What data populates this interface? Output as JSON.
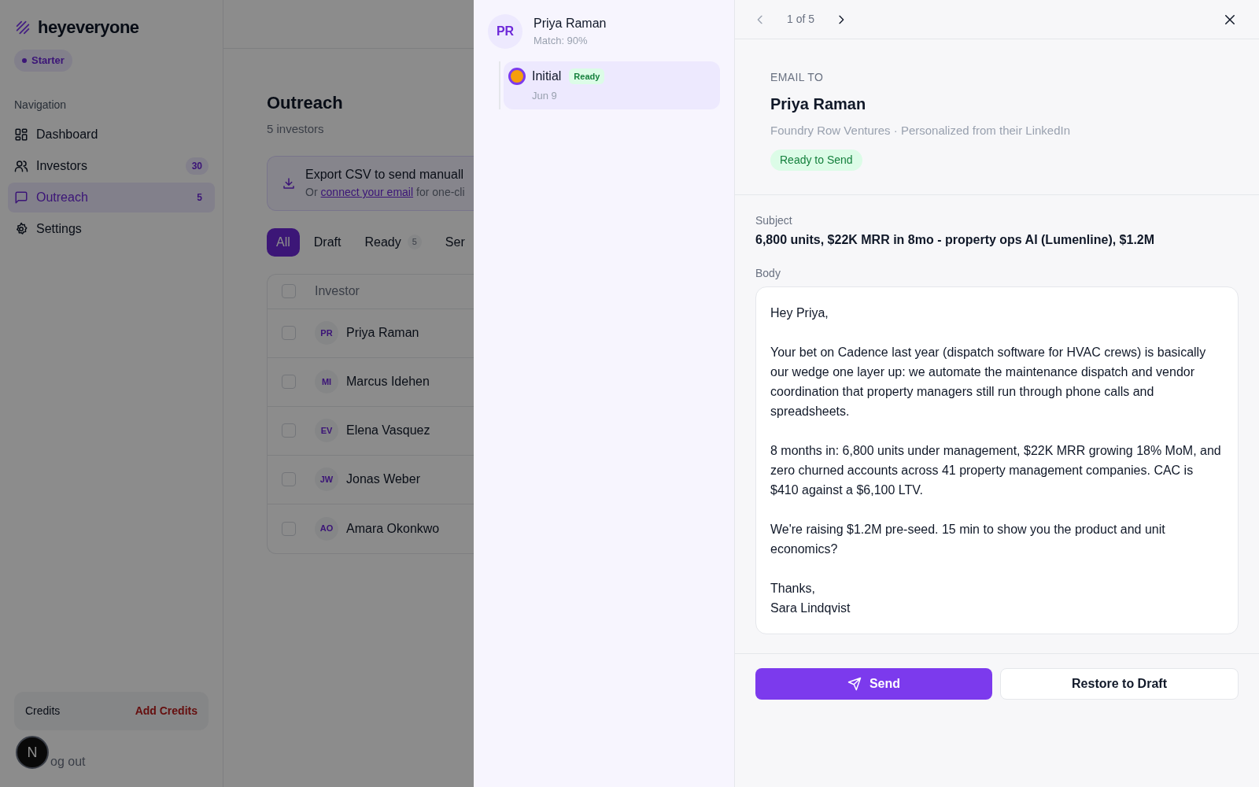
{
  "sidebar": {
    "brand": "heyeveryone",
    "plan": "Starter",
    "section_label": "Navigation",
    "items": [
      {
        "label": "Dashboard",
        "selected": false
      },
      {
        "label": "Investors",
        "badge": "30",
        "selected": false
      },
      {
        "label": "Outreach",
        "badge": "5",
        "selected": true
      },
      {
        "label": "Settings",
        "selected": false
      }
    ],
    "credits": {
      "label": "Credits",
      "action": "Add Credits"
    },
    "dev_button": "N",
    "logout": "og out"
  },
  "main": {
    "title": "Outreach",
    "subtitle": "5 investors",
    "export": {
      "title": "Export CSV to send manuall",
      "prefix": "Or ",
      "link": "connect your email",
      "suffix": " for one-cli"
    },
    "tabs": [
      {
        "label": "All",
        "selected": true
      },
      {
        "label": "Draft",
        "selected": false
      },
      {
        "label": "Ready",
        "count": "5",
        "selected": false
      },
      {
        "label": "Ser",
        "selected": false
      }
    ],
    "table": {
      "select_all_checked": false,
      "columns": [
        "Investor"
      ],
      "rows": [
        {
          "initials": "PR",
          "name": "Priya Raman",
          "checked": false
        },
        {
          "initials": "MI",
          "name": "Marcus Idehen",
          "checked": false
        },
        {
          "initials": "EV",
          "name": "Elena Vasquez",
          "checked": false
        },
        {
          "initials": "JW",
          "name": "Jonas Weber",
          "checked": false
        },
        {
          "initials": "AO",
          "name": "Amara Okonkwo",
          "checked": false
        }
      ]
    }
  },
  "sequence": {
    "initials": "PR",
    "name": "Priya Raman",
    "match": "Match: 90%",
    "steps": [
      {
        "label": "Initial",
        "status": "Ready",
        "date": "Jun 9",
        "selected": true
      }
    ]
  },
  "detail": {
    "pager": {
      "prev_disabled": true,
      "next_disabled": false,
      "position": "1 of 5"
    },
    "eyebrow": "EMAIL TO",
    "recipient": "Priya Raman",
    "meta": "Foundry Row Ventures · Personalized from their LinkedIn",
    "status": "Ready to Send",
    "subject_label": "Subject",
    "subject": "6,800 units, $22K MRR in 8mo - property ops AI (Lumenline), $1.2M",
    "body_label": "Body",
    "body": [
      "Hey Priya,",
      "Your bet on Cadence last year (dispatch software for HVAC crews) is basically our wedge one layer up: we automate the maintenance dispatch and vendor coordination that property managers still run through phone calls and spreadsheets.",
      "8 months in: 6,800 units under management, $22K MRR growing 18% MoM, and zero churned accounts across 41 property management companies. CAC is $410 against a $6,100 LTV.",
      "We're raising $1.2M pre-seed. 15 min to show you the product and unit economics?",
      "Thanks,\nSara Lindqvist"
    ],
    "send": "Send",
    "restore": "Restore to Draft"
  }
}
